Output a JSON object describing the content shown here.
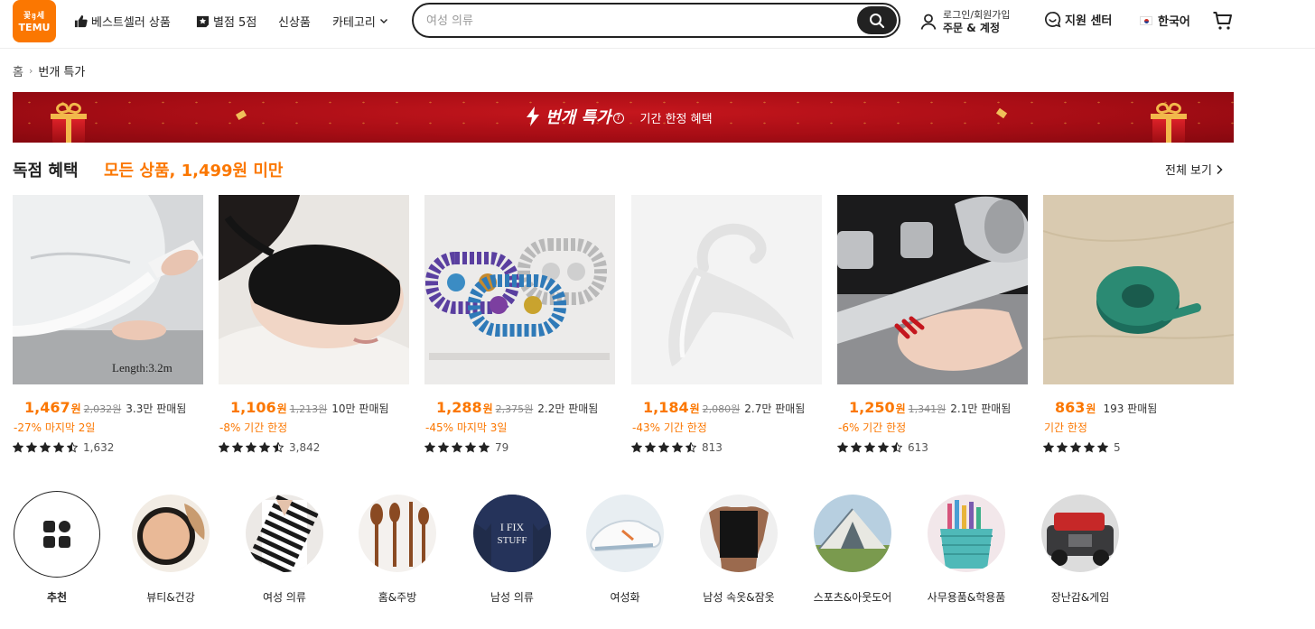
{
  "header": {
    "logo_top": "꽃ᥠ세",
    "logo_text": "TEMU",
    "nav": [
      {
        "label": "베스트셀러 상품",
        "icon": "thumbs-up-icon"
      },
      {
        "label": "별점 5점",
        "icon": "star-badge-icon"
      },
      {
        "label": "신상품",
        "icon": ""
      },
      {
        "label": "카테고리",
        "icon": "chevron-down-icon"
      }
    ],
    "search_placeholder": "여성 의류",
    "account_line1": "로그인/회원가입",
    "account_line2": "주문 & 계정",
    "support_label": "지원 센터",
    "language_label": "한국어"
  },
  "breadcrumb": {
    "home": "홈",
    "current": "번개 특가"
  },
  "banner": {
    "title": "번개 특가",
    "help": "?",
    "subtitle": "기간 한정 혜택"
  },
  "section": {
    "title": "독점 혜택",
    "promo": "모든 상품, 1,499원 미만",
    "see_all": "전체 보기"
  },
  "products": [
    {
      "price": "1,467",
      "currency": "원",
      "original": "2,032원",
      "sold": "3.3만 판매됨",
      "promo": "-27% 마지막 2일",
      "rating": 4.5,
      "reviews": "1,632",
      "image_text": "Length:3.2m"
    },
    {
      "price": "1,106",
      "currency": "원",
      "original": "1,213원",
      "sold": "10만 판매됨",
      "promo": "-8% 기간 한정",
      "rating": 4.5,
      "reviews": "3,842"
    },
    {
      "price": "1,288",
      "currency": "원",
      "original": "2,375원",
      "sold": "2.2만 판매됨",
      "promo": "-45% 마지막 3일",
      "rating": 5,
      "reviews": "79"
    },
    {
      "price": "1,184",
      "currency": "원",
      "original": "2,080원",
      "sold": "2.7만 판매됨",
      "promo": "-43% 기간 한정",
      "rating": 4.5,
      "reviews": "813"
    },
    {
      "price": "1,250",
      "currency": "원",
      "original": "1,341원",
      "sold": "2.1만 판매됨",
      "promo": "-6% 기간 한정",
      "rating": 4.5,
      "reviews": "613"
    },
    {
      "price": "863",
      "currency": "원",
      "original": "",
      "sold": "193 판매됨",
      "promo": "기간 한정",
      "rating": 5,
      "reviews": "5"
    }
  ],
  "categories": [
    {
      "label": "추천"
    },
    {
      "label": "뷰티&건강"
    },
    {
      "label": "여성 의류"
    },
    {
      "label": "홈&주방"
    },
    {
      "label": "남성 의류"
    },
    {
      "label": "여성화"
    },
    {
      "label": "남성 속옷&잠옷"
    },
    {
      "label": "스포츠&아웃도어"
    },
    {
      "label": "사무용품&학용품"
    },
    {
      "label": "장난감&게임"
    }
  ],
  "colors": {
    "brand": "#fb7701",
    "banner": "#b3121a",
    "text": "#222222"
  }
}
